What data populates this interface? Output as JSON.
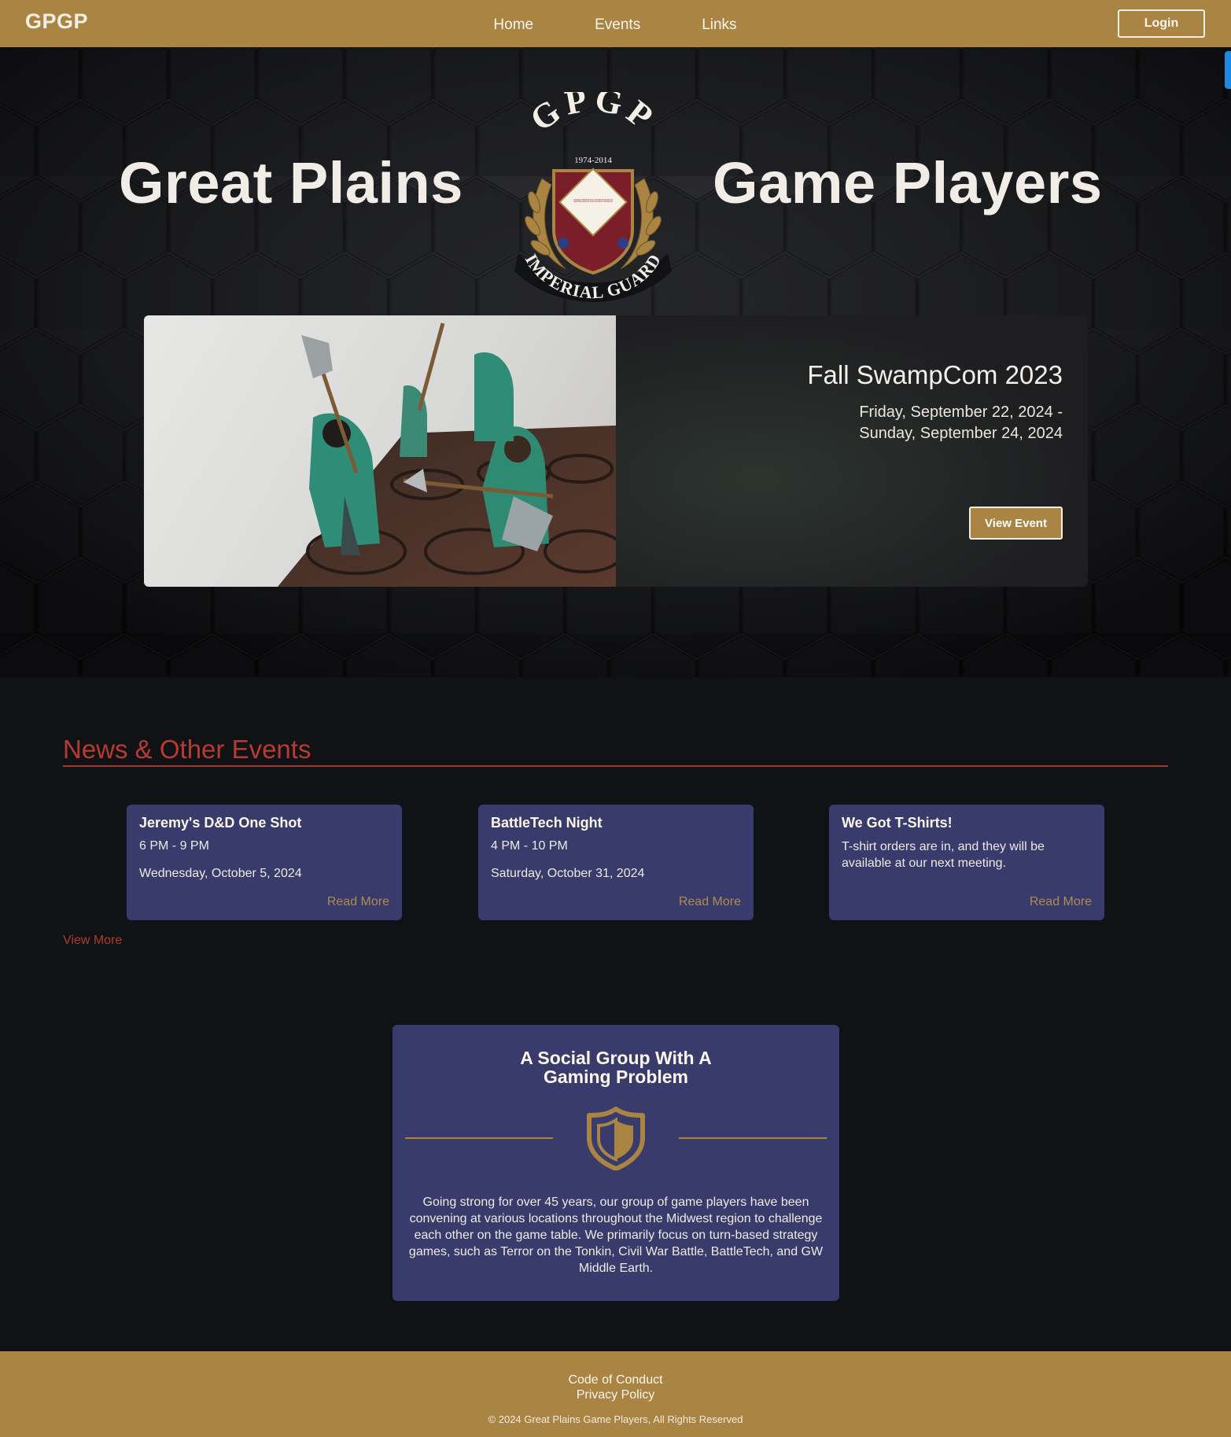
{
  "nav": {
    "brand": "GPGP",
    "links": [
      "Home",
      "Events",
      "Links"
    ],
    "login_label": "Login"
  },
  "hero": {
    "title_left": "Great Plains",
    "title_right": "Game Players",
    "crest": {
      "top_text": "GPGP",
      "years": "1974-2014",
      "center_text": "GARDE IMPERIALE L'EMPEREUR DES FRANCAIS AU 1ER REGIMENT DES GRENADIERS A PIED",
      "banner_text": "IMPERIAL GUARD"
    },
    "featured_event": {
      "title": "Fall SwampCom 2023",
      "date_line1": "Friday, September 22, 2024 -",
      "date_line2": "Sunday, September 24, 2024",
      "button_label": "View Event"
    }
  },
  "news": {
    "heading": "News & Other Events",
    "cards": [
      {
        "title": "Jeremy's D&D One Shot",
        "time": "6 PM - 9 PM",
        "date": "Wednesday, October 5, 2024",
        "more": "Read More"
      },
      {
        "title": "BattleTech Night",
        "time": "4 PM - 10 PM",
        "date": "Saturday, October 31, 2024",
        "more": "Read More"
      },
      {
        "title": "We Got T-Shirts!",
        "body": "T-shirt orders are in, and they will be available at our next meeting.",
        "more": "Read More"
      }
    ],
    "view_more": "View More"
  },
  "social": {
    "title_line1": "A Social Group With A",
    "title_line2": "Gaming Problem",
    "text": "Going strong for over 45 years, our group of game players have been convening at various locations throughout the Midwest region to challenge each other on the game table. We primarily focus on turn-based strategy games, such as Terror on the Tonkin, Civil War Battle, BattleTech, and GW Middle Earth."
  },
  "footer": {
    "links": [
      "Code of Conduct",
      "Privacy Policy"
    ],
    "copyright": "© 2024 Great Plains Game Players, All Rights Reserved"
  },
  "colors": {
    "brand_gold": "#a98443",
    "card_navy": "#383b6b",
    "accent_red": "#b63c2f",
    "page_bg": "#111216"
  }
}
